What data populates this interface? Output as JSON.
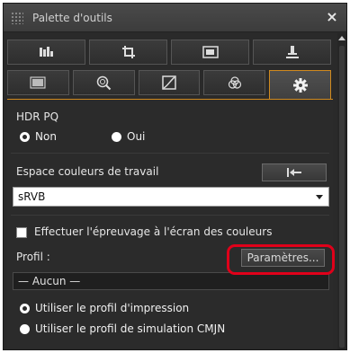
{
  "window": {
    "title": "Palette d'outils",
    "close_glyph": "×"
  },
  "tabs_row1": [
    {
      "icon": "histogram-icon",
      "label": ""
    },
    {
      "icon": "crop-icon",
      "label": ""
    },
    {
      "icon": "image-icon",
      "label": ""
    },
    {
      "icon": "stamp-icon",
      "label": ""
    }
  ],
  "tabs_row2": [
    {
      "icon": "picture-style-icon",
      "active": false
    },
    {
      "icon": "lens-search-icon",
      "active": false
    },
    {
      "icon": "tone-curve-icon",
      "active": false
    },
    {
      "icon": "color-wheel-icon",
      "active": false
    },
    {
      "icon": "gear-icon",
      "active": true
    }
  ],
  "hdr": {
    "label": "HDR PQ",
    "option_non": "Non",
    "option_oui": "Oui",
    "selected": "Non"
  },
  "workspace": {
    "label": "Espace couleurs de travail",
    "reset_glyph": "|⟵",
    "select_value": "sRVB"
  },
  "proofing": {
    "checkbox_label": "Effectuer l'épreuvage à l'écran des couleurs",
    "checked": false,
    "profile_label": "Profil :",
    "params_button": "Paramètres...",
    "profile_value": "— Aucun —",
    "option_print": "Utiliser le profil d'impression",
    "option_cmyk": "Utiliser le profil de simulation CMJN",
    "selected": "print"
  },
  "colors": {
    "accent": "#d08a1e",
    "highlight": "#e0001a"
  }
}
